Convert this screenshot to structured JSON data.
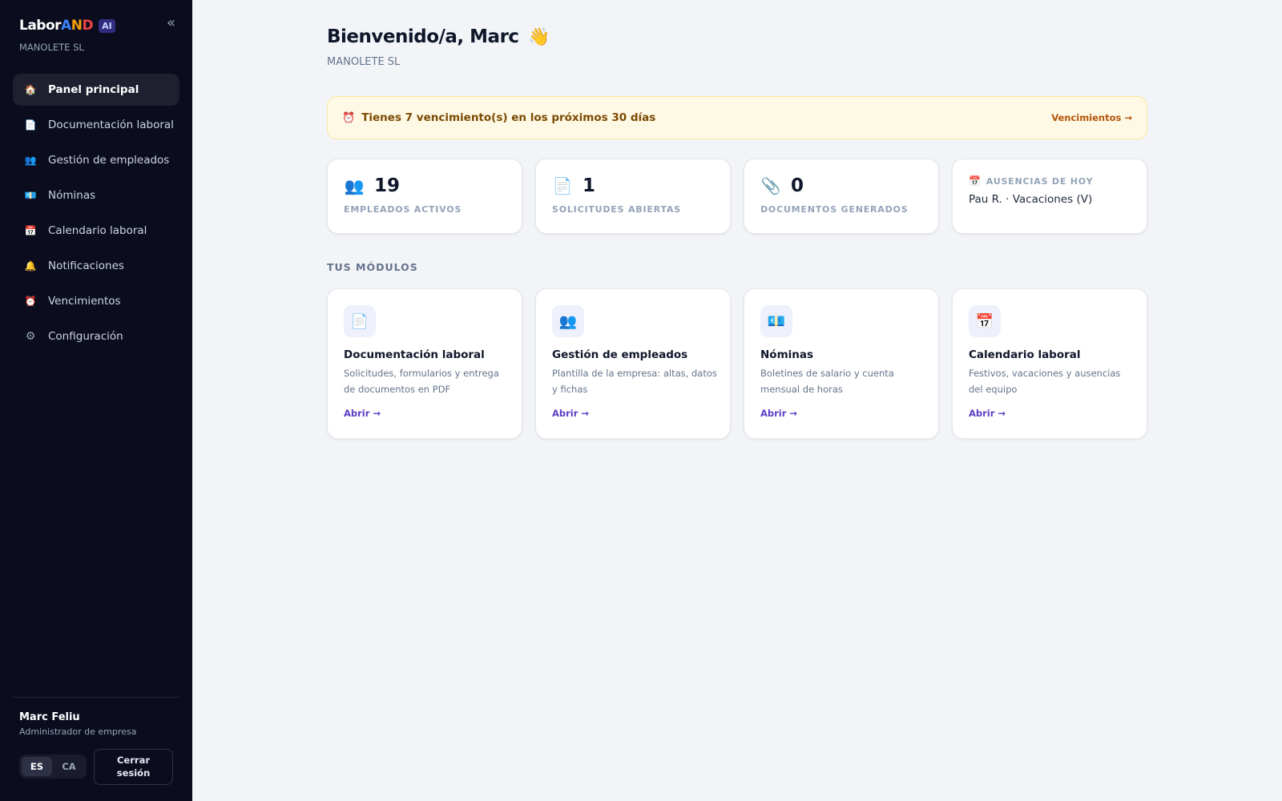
{
  "brand": {
    "labor": "Labor",
    "a": "A",
    "n": "N",
    "d": "D",
    "ai": "AI"
  },
  "sidebar": {
    "company": "MANOLETE SL",
    "collapse_glyph": "«",
    "items": [
      {
        "label": "Panel principal",
        "icon": "house-icon",
        "glyph": "🏠",
        "active": true
      },
      {
        "label": "Documentación laboral",
        "icon": "document-icon",
        "glyph": "📄"
      },
      {
        "label": "Gestión de empleados",
        "icon": "people-icon",
        "glyph": "👥"
      },
      {
        "label": "Nóminas",
        "icon": "money-icon",
        "glyph": "💶"
      },
      {
        "label": "Calendario laboral",
        "icon": "calendar-icon",
        "glyph": "📅"
      },
      {
        "label": "Notificaciones",
        "icon": "bell-icon",
        "glyph": "🔔"
      },
      {
        "label": "Vencimientos",
        "icon": "alarm-clock-icon",
        "glyph": "⏰"
      },
      {
        "label": "Configuración",
        "icon": "gear-icon",
        "glyph": "⚙"
      }
    ],
    "user": {
      "name": "Marc Feliu",
      "role": "Administrador de empresa"
    },
    "languages": [
      "ES",
      "CA"
    ],
    "active_language": "ES",
    "logout": "Cerrar sesión"
  },
  "header": {
    "title": "Bienvenido/a, Marc",
    "wave": "👋",
    "company": "MANOLETE SL"
  },
  "alert": {
    "glyph": "⏰",
    "text": "Tienes 7 vencimiento(s) en los próximos 30 días",
    "link": "Vencimientos →"
  },
  "stats": [
    {
      "value": "19",
      "label": "EMPLEADOS ACTIVOS",
      "icon": "people-icon",
      "glyph": "👥"
    },
    {
      "value": "1",
      "label": "SOLICITUDES ABIERTAS",
      "icon": "document-icon",
      "glyph": "📄"
    },
    {
      "value": "0",
      "label": "DOCUMENTOS GENERADOS",
      "icon": "paperclip-icon",
      "glyph": "📎"
    }
  ],
  "absences": {
    "title": "AUSENCIAS DE HOY",
    "glyph": "📅",
    "entry": "Pau R. · Vacaciones (V)"
  },
  "modules_title": "TUS MÓDULOS",
  "modules": [
    {
      "title": "Documentación laboral",
      "desc": "Solicitudes, formularios y entrega de documentos en PDF",
      "open": "Abrir →",
      "icon": "document-icon",
      "glyph": "📄"
    },
    {
      "title": "Gestión de empleados",
      "desc": "Plantilla de la empresa: altas, datos y fichas",
      "open": "Abrir →",
      "icon": "people-icon",
      "glyph": "👥"
    },
    {
      "title": "Nóminas",
      "desc": "Boletines de salario y cuenta mensual de horas",
      "open": "Abrir →",
      "icon": "money-icon",
      "glyph": "💶"
    },
    {
      "title": "Calendario laboral",
      "desc": "Festivos, vacaciones y ausencias del equipo",
      "open": "Abrir →",
      "icon": "calendar-icon",
      "glyph": "📅"
    }
  ]
}
